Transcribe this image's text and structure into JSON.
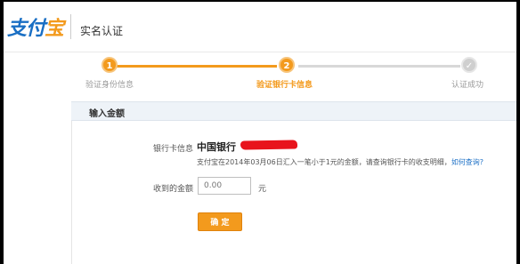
{
  "header": {
    "logo_main": "支付",
    "logo_accent": "宝",
    "title": "实名认证"
  },
  "steps": [
    {
      "number": "1",
      "label": "验证身份信息",
      "state": "done"
    },
    {
      "number": "2",
      "label": "验证银行卡信息",
      "state": "current"
    },
    {
      "number": "✓",
      "label": "认证成功",
      "state": "todo"
    }
  ],
  "panel": {
    "title": "输入金额",
    "bank_label": "银行卡信息",
    "bank_name": "中国银行",
    "hint_text": "支付宝在2014年03月06日汇入一笔小于1元的金额，请查询银行卡的收支明细，",
    "hint_link": "如何查询?",
    "amount_label": "收到的金额",
    "amount_placeholder": "0.00",
    "unit": "元",
    "confirm_label": "确 定"
  },
  "colors": {
    "accent": "#f39a1d",
    "brand_blue": "#1a6fc4",
    "redaction": "#e8141c"
  }
}
